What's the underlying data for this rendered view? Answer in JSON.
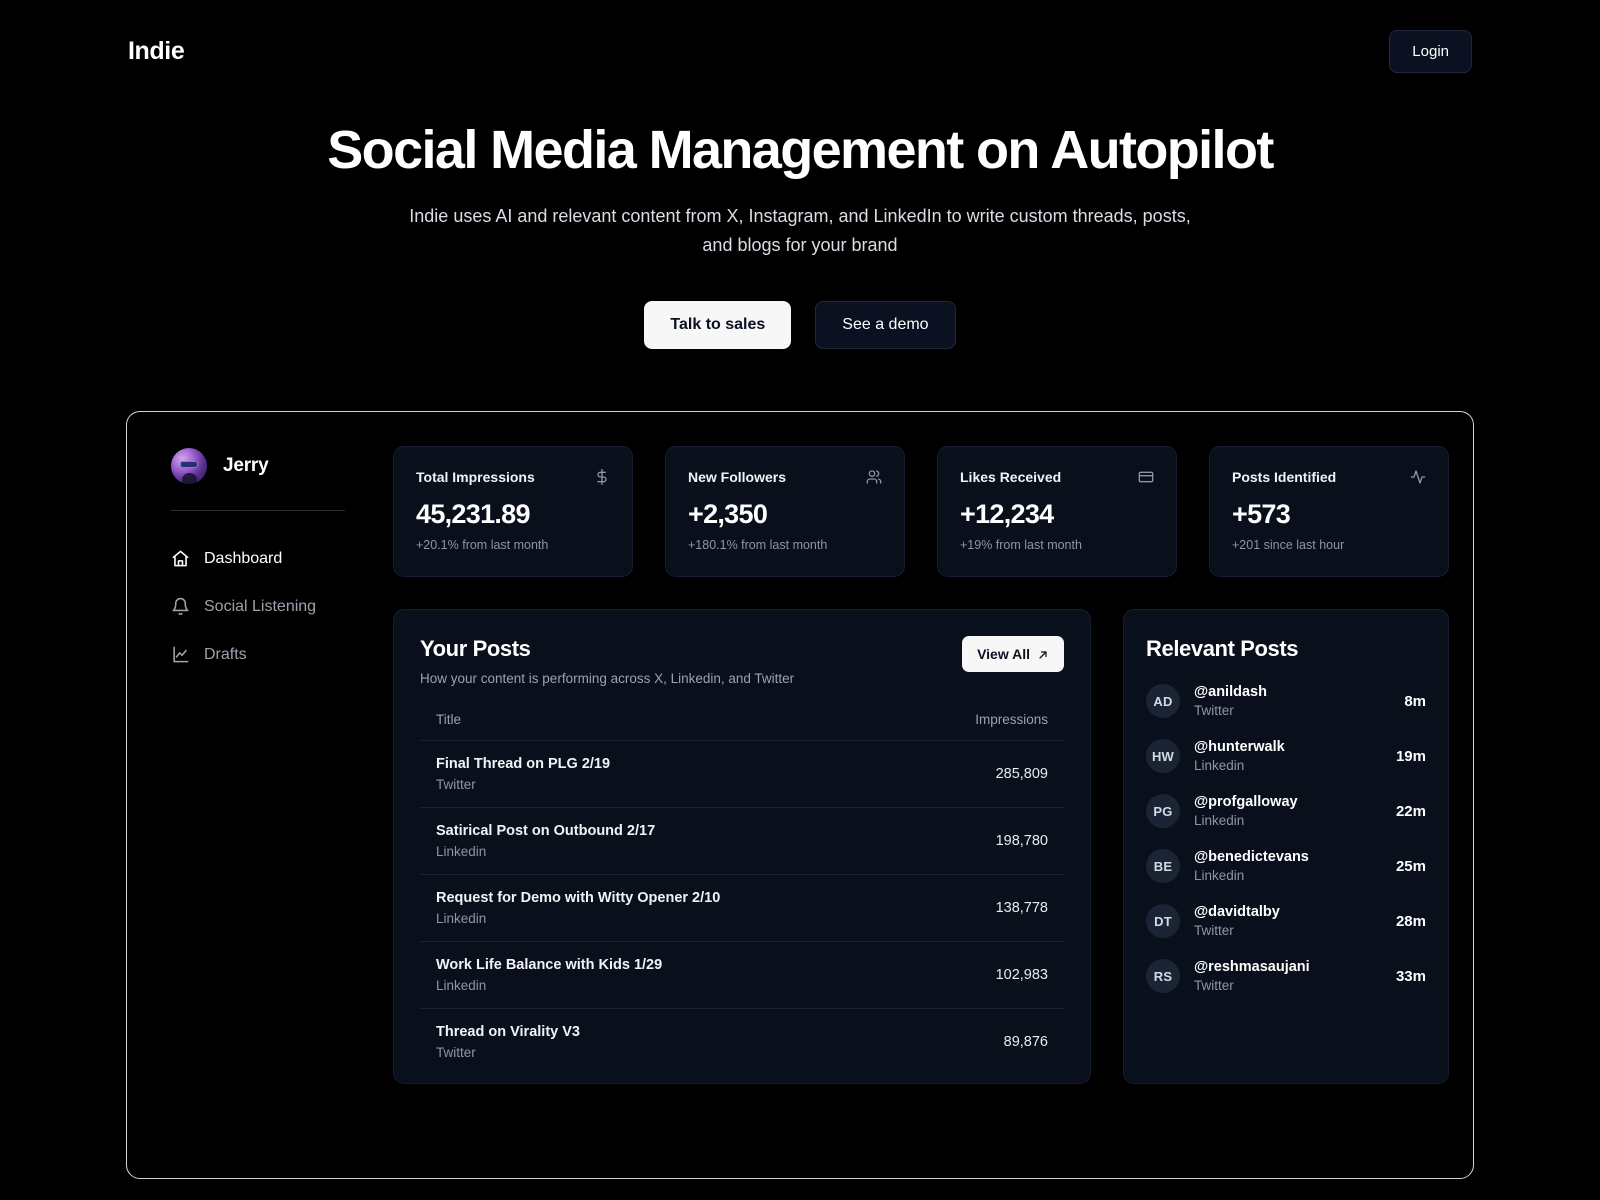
{
  "brand": {
    "logo": "Indie"
  },
  "topnav": {
    "login_label": "Login"
  },
  "hero": {
    "title": "Social Media Management on Autopilot",
    "subtitle": "Indie uses AI and relevant content from X, Instagram, and LinkedIn to write custom threads, posts, and blogs for your brand",
    "primary_cta": "Talk to sales",
    "secondary_cta": "See a demo"
  },
  "sidebar": {
    "profile_name": "Jerry",
    "avatar_icon": "user-avatar-image",
    "items": [
      {
        "label": "Dashboard",
        "icon": "home-icon",
        "active": true
      },
      {
        "label": "Social Listening",
        "icon": "bell-icon",
        "active": false
      },
      {
        "label": "Drafts",
        "icon": "line-chart-icon",
        "active": false
      }
    ]
  },
  "stats": [
    {
      "label": "Total Impressions",
      "value": "45,231.89",
      "delta": "+20.1% from last month",
      "icon": "dollar-sign-icon"
    },
    {
      "label": "New Followers",
      "value": "+2,350",
      "delta": "+180.1% from last month",
      "icon": "users-icon"
    },
    {
      "label": "Likes Received",
      "value": "+12,234",
      "delta": "+19% from last month",
      "icon": "credit-card-icon"
    },
    {
      "label": "Posts Identified",
      "value": "+573",
      "delta": "+201 since last hour",
      "icon": "activity-icon"
    }
  ],
  "posts_panel": {
    "title": "Your Posts",
    "subtitle": "How your content is performing across X, Linkedin, and Twitter",
    "view_all_label": "View All",
    "view_all_icon": "arrow-up-right-icon",
    "columns": {
      "title": "Title",
      "impressions": "Impressions"
    },
    "rows": [
      {
        "title": "Final Thread on PLG 2/19",
        "platform": "Twitter",
        "impressions": "285,809"
      },
      {
        "title": "Satirical Post on Outbound 2/17",
        "platform": "Linkedin",
        "impressions": "198,780"
      },
      {
        "title": "Request for Demo with Witty Opener 2/10",
        "platform": "Linkedin",
        "impressions": "138,778"
      },
      {
        "title": "Work Life Balance with Kids 1/29",
        "platform": "Linkedin",
        "impressions": "102,983"
      },
      {
        "title": "Thread on Virality V3",
        "platform": "Twitter",
        "impressions": "89,876"
      }
    ]
  },
  "relevant_panel": {
    "title": "Relevant Posts",
    "items": [
      {
        "initials": "AD",
        "handle": "@anildash",
        "platform": "Twitter",
        "time": "8m"
      },
      {
        "initials": "HW",
        "handle": "@hunterwalk",
        "platform": "Linkedin",
        "time": "19m"
      },
      {
        "initials": "PG",
        "handle": "@profgalloway",
        "platform": "Linkedin",
        "time": "22m"
      },
      {
        "initials": "BE",
        "handle": "@benedictevans",
        "platform": "Linkedin",
        "time": "25m"
      },
      {
        "initials": "DT",
        "handle": "@davidtalby",
        "platform": "Twitter",
        "time": "28m"
      },
      {
        "initials": "RS",
        "handle": "@reshmasaujani",
        "platform": "Twitter",
        "time": "33m"
      }
    ]
  },
  "colors": {
    "page_bg": "#000000",
    "card_bg": "#0a0f1c",
    "card_border": "#151d2e",
    "shell_border": "#cfd3d8",
    "muted_text": "#8d96a3",
    "accent_light": "#f7f7f8"
  }
}
